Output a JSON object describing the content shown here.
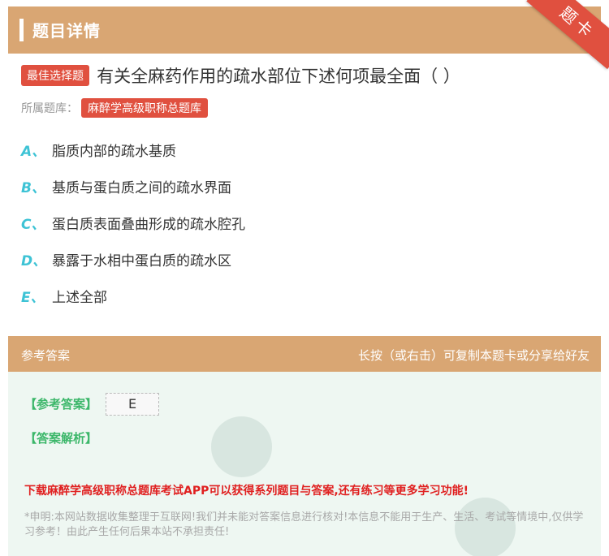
{
  "header": {
    "title": "题目详情"
  },
  "ribbon": {
    "label": "题卡"
  },
  "question": {
    "tag": "最佳选择题",
    "text": "有关全麻药作用的疏水部位下述何项最全面（      ）"
  },
  "bank": {
    "label": "所属题库：",
    "name": "麻醉学高级职称总题库"
  },
  "options": [
    {
      "letter": "A、",
      "text": "脂质内部的疏水基质"
    },
    {
      "letter": "B、",
      "text": "基质与蛋白质之间的疏水界面"
    },
    {
      "letter": "C、",
      "text": "蛋白质表面叠曲形成的疏水腔孔"
    },
    {
      "letter": "D、",
      "text": "暴露于水相中蛋白质的疏水区"
    },
    {
      "letter": "E、",
      "text": "上述全部"
    }
  ],
  "answer_section": {
    "title": "参考答案",
    "hint": "长按（或右击）可复制本题卡或分享给好友",
    "answer_label": "【参考答案】",
    "answer_value": "E",
    "analysis_label": "【答案解析】",
    "promo": "下载麻醉学高级职称总题库考试APP可以获得系列题目与答案,还有练习等更多学习功能!",
    "disclaimer": "*申明:本网站数据收集整理于互联网!我们并未能对答案信息进行核对!本信息不能用于生产、生活、考试等情境中,仅供学习参考！由此产生任何后果本站不承担责任!"
  },
  "colors": {
    "accent": "#d9a673",
    "tag": "#e0503f",
    "option_letter": "#3ec3d5",
    "answer_green": "#3cb76a",
    "promo_red": "#e02020"
  }
}
